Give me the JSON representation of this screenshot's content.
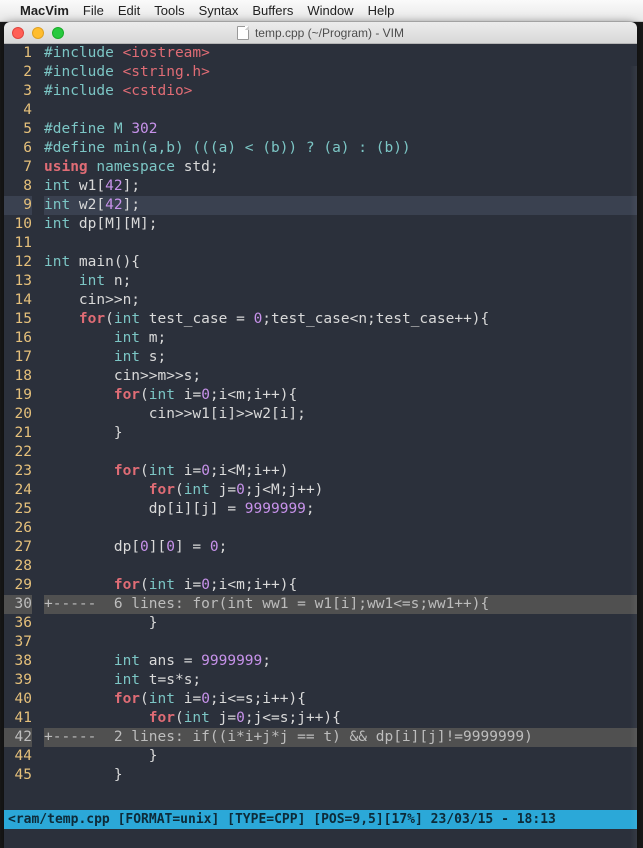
{
  "menubar": {
    "apple": "",
    "app": "MacVim",
    "items": [
      "File",
      "Edit",
      "Tools",
      "Syntax",
      "Buffers",
      "Window",
      "Help"
    ]
  },
  "window": {
    "title": "temp.cpp (~/Program) - VIM"
  },
  "statusline": "<ram/temp.cpp [FORMAT=unix] [TYPE=CPP] [POS=9,5][17%] 23/03/15 - 18:13",
  "lines": [
    {
      "n": "1",
      "tokens": [
        [
          "kw-pre",
          "#include "
        ],
        [
          "inc",
          "<iostream>"
        ]
      ]
    },
    {
      "n": "2",
      "tokens": [
        [
          "kw-pre",
          "#include "
        ],
        [
          "inc",
          "<string.h>"
        ]
      ]
    },
    {
      "n": "3",
      "tokens": [
        [
          "kw-pre",
          "#include "
        ],
        [
          "inc",
          "<cstdio>"
        ]
      ]
    },
    {
      "n": "4",
      "tokens": []
    },
    {
      "n": "5",
      "tokens": [
        [
          "kw-pre",
          "#define M "
        ],
        [
          "num",
          "302"
        ]
      ]
    },
    {
      "n": "6",
      "tokens": [
        [
          "kw-pre",
          "#define min(a,b) (((a) < (b)) ? (a) : (b))"
        ]
      ]
    },
    {
      "n": "7",
      "tokens": [
        [
          "kw-red",
          "using "
        ],
        [
          "kw-grn",
          "namespace"
        ],
        [
          "plain",
          " std;"
        ]
      ]
    },
    {
      "n": "8",
      "tokens": [
        [
          "type",
          "int"
        ],
        [
          "plain",
          " w1["
        ],
        [
          "num",
          "42"
        ],
        [
          "plain",
          "];"
        ]
      ]
    },
    {
      "n": "9",
      "hl": true,
      "tokens": [
        [
          "type",
          "int"
        ],
        [
          "plain",
          " w2["
        ],
        [
          "num",
          "42"
        ],
        [
          "plain",
          "];"
        ]
      ]
    },
    {
      "n": "10",
      "tokens": [
        [
          "type",
          "int"
        ],
        [
          "plain",
          " dp[M][M];"
        ]
      ]
    },
    {
      "n": "11",
      "tokens": []
    },
    {
      "n": "12",
      "tokens": [
        [
          "type",
          "int"
        ],
        [
          "plain",
          " main(){"
        ]
      ]
    },
    {
      "n": "13",
      "tokens": [
        [
          "plain",
          "    "
        ],
        [
          "type",
          "int"
        ],
        [
          "plain",
          " n;"
        ]
      ]
    },
    {
      "n": "14",
      "tokens": [
        [
          "plain",
          "    cin>>n;"
        ]
      ]
    },
    {
      "n": "15",
      "tokens": [
        [
          "plain",
          "    "
        ],
        [
          "ctrl",
          "for"
        ],
        [
          "plain",
          "("
        ],
        [
          "type",
          "int"
        ],
        [
          "plain",
          " test_case = "
        ],
        [
          "num",
          "0"
        ],
        [
          "plain",
          ";test_case<n;test_case++){"
        ]
      ]
    },
    {
      "n": "16",
      "tokens": [
        [
          "plain",
          "        "
        ],
        [
          "type",
          "int"
        ],
        [
          "plain",
          " m;"
        ]
      ]
    },
    {
      "n": "17",
      "tokens": [
        [
          "plain",
          "        "
        ],
        [
          "type",
          "int"
        ],
        [
          "plain",
          " s;"
        ]
      ]
    },
    {
      "n": "18",
      "tokens": [
        [
          "plain",
          "        cin>>m>>s;"
        ]
      ]
    },
    {
      "n": "19",
      "tokens": [
        [
          "plain",
          "        "
        ],
        [
          "ctrl",
          "for"
        ],
        [
          "plain",
          "("
        ],
        [
          "type",
          "int"
        ],
        [
          "plain",
          " i="
        ],
        [
          "num",
          "0"
        ],
        [
          "plain",
          ";i<m;i++){"
        ]
      ]
    },
    {
      "n": "20",
      "tokens": [
        [
          "plain",
          "            cin>>w1[i]>>w2[i];"
        ]
      ]
    },
    {
      "n": "21",
      "tokens": [
        [
          "plain",
          "        }"
        ]
      ]
    },
    {
      "n": "22",
      "tokens": []
    },
    {
      "n": "23",
      "tokens": [
        [
          "plain",
          "        "
        ],
        [
          "ctrl",
          "for"
        ],
        [
          "plain",
          "("
        ],
        [
          "type",
          "int"
        ],
        [
          "plain",
          " i="
        ],
        [
          "num",
          "0"
        ],
        [
          "plain",
          ";i<M;i++)"
        ]
      ]
    },
    {
      "n": "24",
      "tokens": [
        [
          "plain",
          "            "
        ],
        [
          "ctrl",
          "for"
        ],
        [
          "plain",
          "("
        ],
        [
          "type",
          "int"
        ],
        [
          "plain",
          " j="
        ],
        [
          "num",
          "0"
        ],
        [
          "plain",
          ";j<M;j++)"
        ]
      ]
    },
    {
      "n": "25",
      "tokens": [
        [
          "plain",
          "            dp[i][j] = "
        ],
        [
          "num",
          "9999999"
        ],
        [
          "plain",
          ";"
        ]
      ]
    },
    {
      "n": "26",
      "tokens": []
    },
    {
      "n": "27",
      "tokens": [
        [
          "plain",
          "        dp["
        ],
        [
          "num",
          "0"
        ],
        [
          "plain",
          "]["
        ],
        [
          "num",
          "0"
        ],
        [
          "plain",
          "] = "
        ],
        [
          "num",
          "0"
        ],
        [
          "plain",
          ";"
        ]
      ]
    },
    {
      "n": "28",
      "tokens": []
    },
    {
      "n": "29",
      "tokens": [
        [
          "plain",
          "        "
        ],
        [
          "ctrl",
          "for"
        ],
        [
          "plain",
          "("
        ],
        [
          "type",
          "int"
        ],
        [
          "plain",
          " i="
        ],
        [
          "num",
          "0"
        ],
        [
          "plain",
          ";i<m;i++){"
        ]
      ]
    },
    {
      "n": "30",
      "fold": true,
      "text": "+-----  6 lines: for(int ww1 = w1[i];ww1<=s;ww1++){"
    },
    {
      "n": "36",
      "tokens": [
        [
          "plain",
          "            }"
        ]
      ]
    },
    {
      "n": "37",
      "tokens": []
    },
    {
      "n": "38",
      "tokens": [
        [
          "plain",
          "        "
        ],
        [
          "type",
          "int"
        ],
        [
          "plain",
          " ans = "
        ],
        [
          "num",
          "9999999"
        ],
        [
          "plain",
          ";"
        ]
      ]
    },
    {
      "n": "39",
      "tokens": [
        [
          "plain",
          "        "
        ],
        [
          "type",
          "int"
        ],
        [
          "plain",
          " t=s*s;"
        ]
      ]
    },
    {
      "n": "40",
      "tokens": [
        [
          "plain",
          "        "
        ],
        [
          "ctrl",
          "for"
        ],
        [
          "plain",
          "("
        ],
        [
          "type",
          "int"
        ],
        [
          "plain",
          " i="
        ],
        [
          "num",
          "0"
        ],
        [
          "plain",
          ";i<=s;i++){"
        ]
      ]
    },
    {
      "n": "41",
      "tokens": [
        [
          "plain",
          "            "
        ],
        [
          "ctrl",
          "for"
        ],
        [
          "plain",
          "("
        ],
        [
          "type",
          "int"
        ],
        [
          "plain",
          " j="
        ],
        [
          "num",
          "0"
        ],
        [
          "plain",
          ";j<=s;j++){"
        ]
      ]
    },
    {
      "n": "42",
      "fold": true,
      "text": "+-----  2 lines: if((i*i+j*j == t) && dp[i][j]!=9999999)"
    },
    {
      "n": "44",
      "tokens": [
        [
          "plain",
          "            }"
        ]
      ]
    },
    {
      "n": "45",
      "tokens": [
        [
          "plain",
          "        }"
        ]
      ]
    }
  ]
}
